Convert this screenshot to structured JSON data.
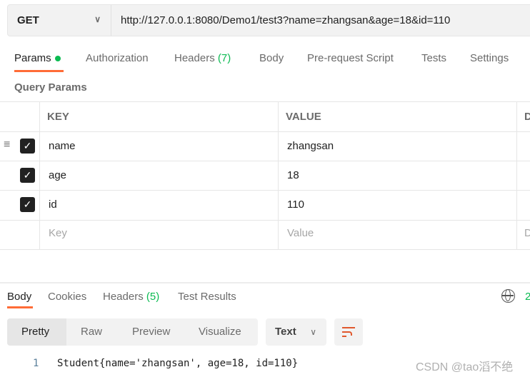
{
  "request": {
    "method": "GET",
    "url": "http://127.0.0.1:8080/Demo1/test3?name=zhangsan&age=18&id=110"
  },
  "request_tabs": [
    {
      "label": "Params"
    },
    {
      "label": "Authorization"
    },
    {
      "label": "Headers",
      "count": "(7)"
    },
    {
      "label": "Body"
    },
    {
      "label": "Pre-request Script"
    },
    {
      "label": "Tests"
    },
    {
      "label": "Settings"
    }
  ],
  "query_params": {
    "title": "Query Params",
    "columns": [
      "KEY",
      "VALUE",
      "D"
    ],
    "rows": [
      {
        "key": "name",
        "value": "zhangsan",
        "checked": true
      },
      {
        "key": "age",
        "value": "18",
        "checked": true
      },
      {
        "key": "id",
        "value": "110",
        "checked": true
      }
    ],
    "placeholder": {
      "key": "Key",
      "value": "Value",
      "desc": "D"
    }
  },
  "response_tabs": [
    {
      "label": "Body"
    },
    {
      "label": "Cookies"
    },
    {
      "label": "Headers",
      "count": "(5)"
    },
    {
      "label": "Test Results"
    }
  ],
  "status_partial": "2",
  "view_modes": [
    "Pretty",
    "Raw",
    "Preview",
    "Visualize"
  ],
  "format": "Text",
  "code": {
    "line": "1",
    "text": "Student{name='zhangsan', age=18, id=110}"
  },
  "watermark": "CSDN @tao滔不绝",
  "colors": {
    "accent": "#ff6c37",
    "green": "#0cbb52"
  }
}
